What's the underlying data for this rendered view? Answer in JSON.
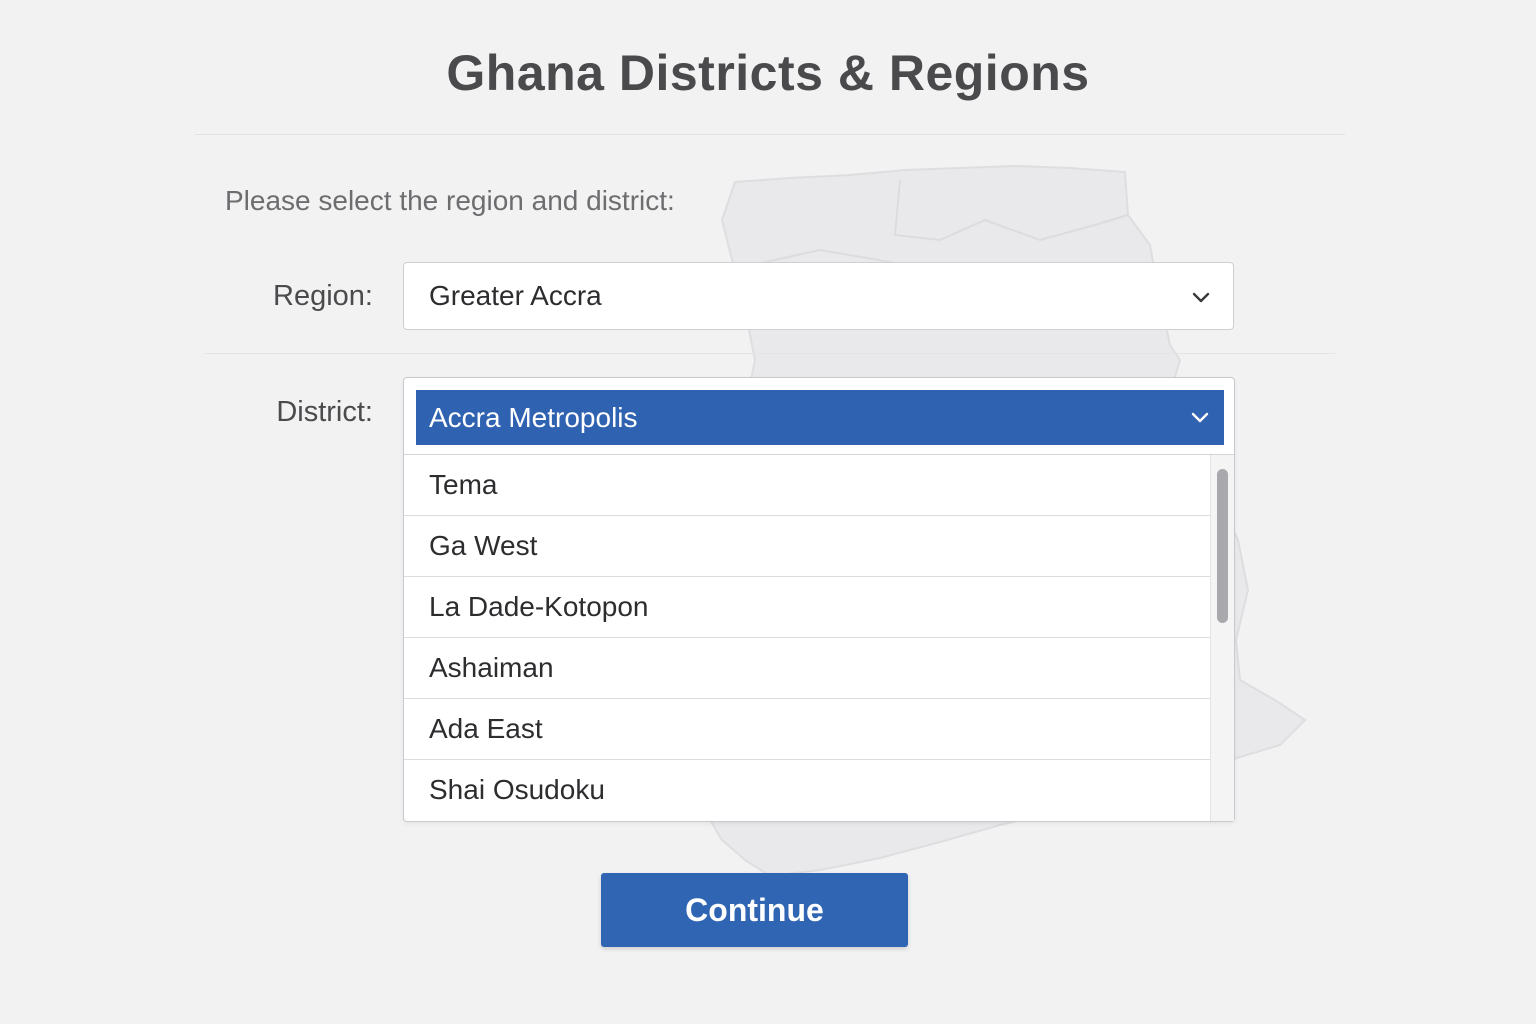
{
  "header": {
    "title": "Ghana Districts & Regions"
  },
  "form": {
    "instructions": "Please select the region and district:",
    "region": {
      "label": "Region:",
      "value": "Greater Accra"
    },
    "district": {
      "label": "District:",
      "value": "Accra Metropolis",
      "options": [
        "Tema",
        "Ga West",
        "La Dade-Kotopon",
        "Ashaiman",
        "Ada East",
        "Shai Osudoku"
      ]
    },
    "continue_label": "Continue"
  },
  "icons": {
    "dropdown": "chevron-down-icon",
    "background": "ghana-map-outline"
  },
  "colors": {
    "accent": "#2f62b0",
    "background": "#f2f2f3",
    "title_text": "#4a4a4c"
  }
}
